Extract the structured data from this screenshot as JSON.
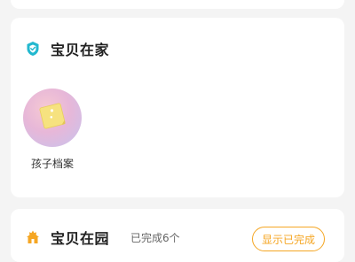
{
  "home": {
    "title": "宝贝在家",
    "icon": "shield-icon",
    "accent": "#22b8cf",
    "tiles": [
      {
        "label": "孩子档案",
        "icon": "note-icon"
      }
    ]
  },
  "school": {
    "title": "宝贝在园",
    "icon": "house-icon",
    "accent": "#f5a623",
    "status": "已完成6个",
    "show_completed_label": "显示已完成"
  }
}
